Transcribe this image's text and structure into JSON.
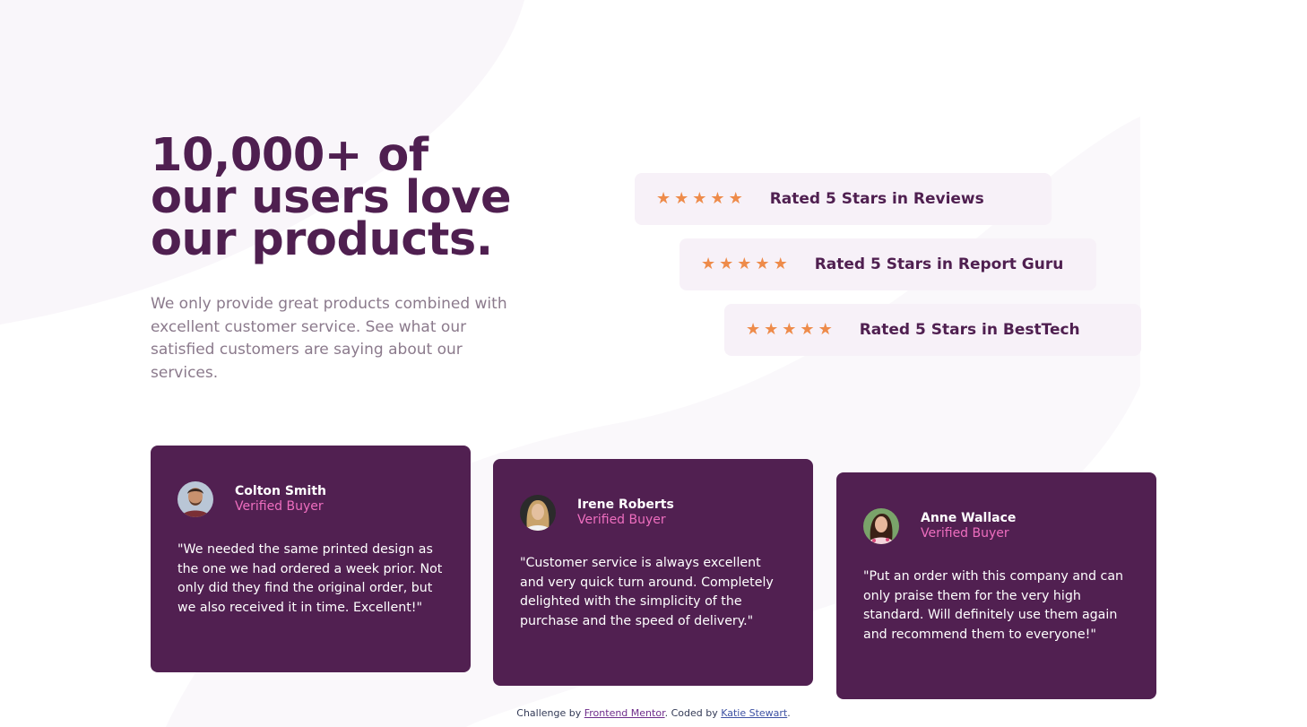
{
  "intro": {
    "heading": "10,000+ of our users love our products.",
    "description": "We only provide great products combined with excellent customer service. See what our satisfied customers are saying about our services."
  },
  "ratings": [
    {
      "stars": 5,
      "label": "Rated 5 Stars in Reviews"
    },
    {
      "stars": 5,
      "label": "Rated 5 Stars in Report Guru"
    },
    {
      "stars": 5,
      "label": "Rated 5 Stars in BestTech"
    }
  ],
  "testimonials": [
    {
      "name": "Colton Smith",
      "role": "Verified Buyer",
      "quote": "\"We needed the same printed design as the one we had ordered a week prior. Not only did they find the original order, but we also received it in time. Excellent!\""
    },
    {
      "name": "Irene Roberts",
      "role": "Verified Buyer",
      "quote": "\"Customer service is always excellent and very quick turn around. Completely delighted with the simplicity of the purchase and the speed of delivery.\""
    },
    {
      "name": "Anne Wallace",
      "role": "Verified Buyer",
      "quote": "\"Put an order with this company and can only praise them for the very high standard. Will definitely use them again and recommend them to everyone!\""
    }
  ],
  "footer": {
    "prefix": "Challenge by ",
    "challenge_link": "Frontend Mentor",
    "middle": ". Coded by ",
    "author_link": "Katie Stewart",
    "suffix": "."
  },
  "colors": {
    "primary_purple": "#4f1f50",
    "card_purple": "#512051",
    "star_orange": "#ee8b4a",
    "accent_pink": "#ee6ebf",
    "rating_bg": "#f7f1f8"
  },
  "icons": {
    "star": "star-icon"
  }
}
